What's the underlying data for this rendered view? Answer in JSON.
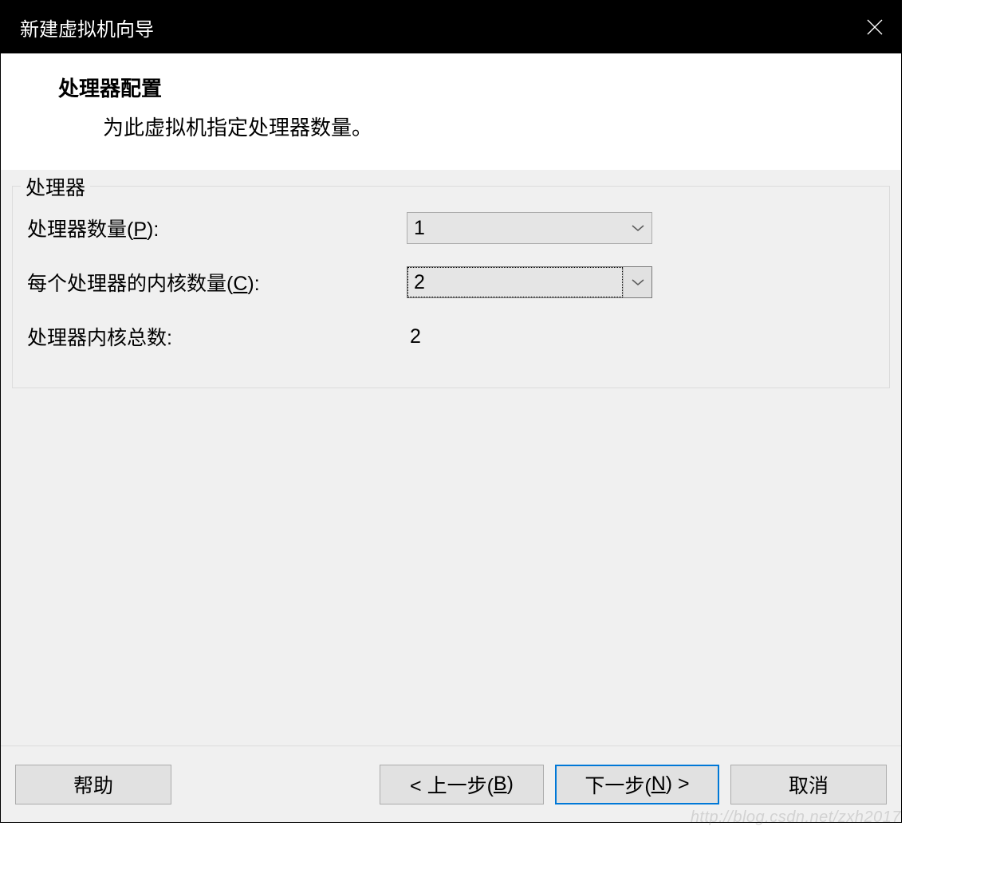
{
  "window": {
    "title": "新建虚拟机向导"
  },
  "header": {
    "title": "处理器配置",
    "subtitle": "为此虚拟机指定处理器数量。"
  },
  "group": {
    "legend": "处理器",
    "rows": {
      "processors": {
        "label_pre": "处理器数量(",
        "label_key": "P",
        "label_post": "):",
        "value": "1"
      },
      "cores": {
        "label_pre": "每个处理器的内核数量(",
        "label_key": "C",
        "label_post": "):",
        "value": "2"
      },
      "total": {
        "label": "处理器内核总数:",
        "value": "2"
      }
    }
  },
  "buttons": {
    "help": "帮助",
    "back_pre": "< 上一步(",
    "back_key": "B",
    "back_post": ")",
    "next_pre": "下一步(",
    "next_key": "N",
    "next_post": ") >",
    "cancel": "取消"
  },
  "watermark": "http://blog.csdn.net/zxh2017"
}
